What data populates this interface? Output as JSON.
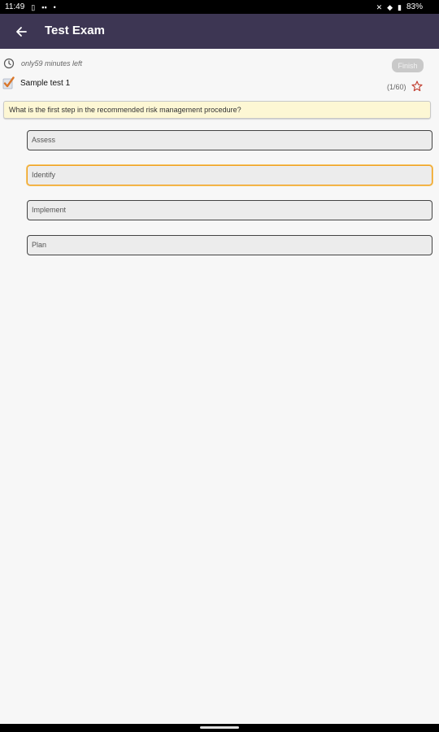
{
  "status_bar": {
    "time": "11:49",
    "battery": "83%",
    "icons": [
      "sim-icon",
      "notification-icon",
      "dot-icon",
      "mute-icon",
      "wifi-icon",
      "battery-icon"
    ]
  },
  "app_bar": {
    "title": "Test Exam",
    "back_icon": "arrow-left-icon"
  },
  "exam": {
    "timer_text": "only59 minutes left",
    "finish_label": "Finish",
    "test_name": "Sample test 1",
    "counter": "(1/60)",
    "question": "What is the first step in the recommended risk management procedure?",
    "options": [
      {
        "label": "Assess",
        "selected": false
      },
      {
        "label": "Identify",
        "selected": true
      },
      {
        "label": "Implement",
        "selected": false
      },
      {
        "label": "Plan",
        "selected": false
      }
    ]
  },
  "colors": {
    "app_bar": "#3d3653",
    "question_bg": "#fdf7d4",
    "selected_border": "#f0a020",
    "finish_bg": "#c9c9c9",
    "star": "#c0392b"
  }
}
